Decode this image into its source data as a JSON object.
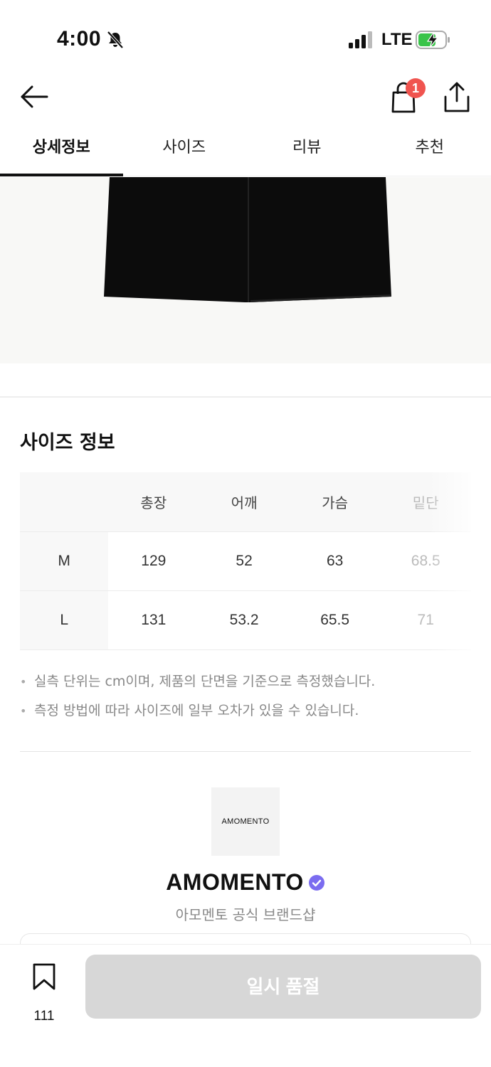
{
  "status_bar": {
    "time": "4:00",
    "network": "LTE",
    "icons": [
      "bell-muted-icon",
      "signal-icon",
      "battery-charging-icon"
    ]
  },
  "header": {
    "cart_badge": "1",
    "icons": [
      "back-arrow-icon",
      "shopping-bag-icon",
      "share-icon"
    ]
  },
  "tabs": [
    {
      "label": "상세정보",
      "active": true
    },
    {
      "label": "사이즈",
      "active": false
    },
    {
      "label": "리뷰",
      "active": false
    },
    {
      "label": "추천",
      "active": false
    }
  ],
  "size_info": {
    "title": "사이즈 정보",
    "columns": [
      "총장",
      "어깨",
      "가슴",
      "밑단"
    ],
    "rows": [
      {
        "size": "M",
        "values": [
          "129",
          "52",
          "63",
          "68.5"
        ]
      },
      {
        "size": "L",
        "values": [
          "131",
          "53.2",
          "65.5",
          "71"
        ]
      }
    ],
    "notes": [
      "실측 단위는 cm이며, 제품의 단면을 기준으로 측정했습니다.",
      "측정 방법에 따라 사이즈에 일부 오차가 있을 수 있습니다."
    ]
  },
  "brand": {
    "logo_text": "AMOMENTO",
    "name": "AMOMENTO",
    "subtitle": "아모멘토 공식 브랜드샵",
    "verified": true
  },
  "bottom_bar": {
    "bookmark_count": "111",
    "cta_label": "일시 품절"
  },
  "colors": {
    "accent_badge": "#f0544f",
    "verified": "#7b6cf0",
    "disabled_button": "#d7d7d7"
  }
}
